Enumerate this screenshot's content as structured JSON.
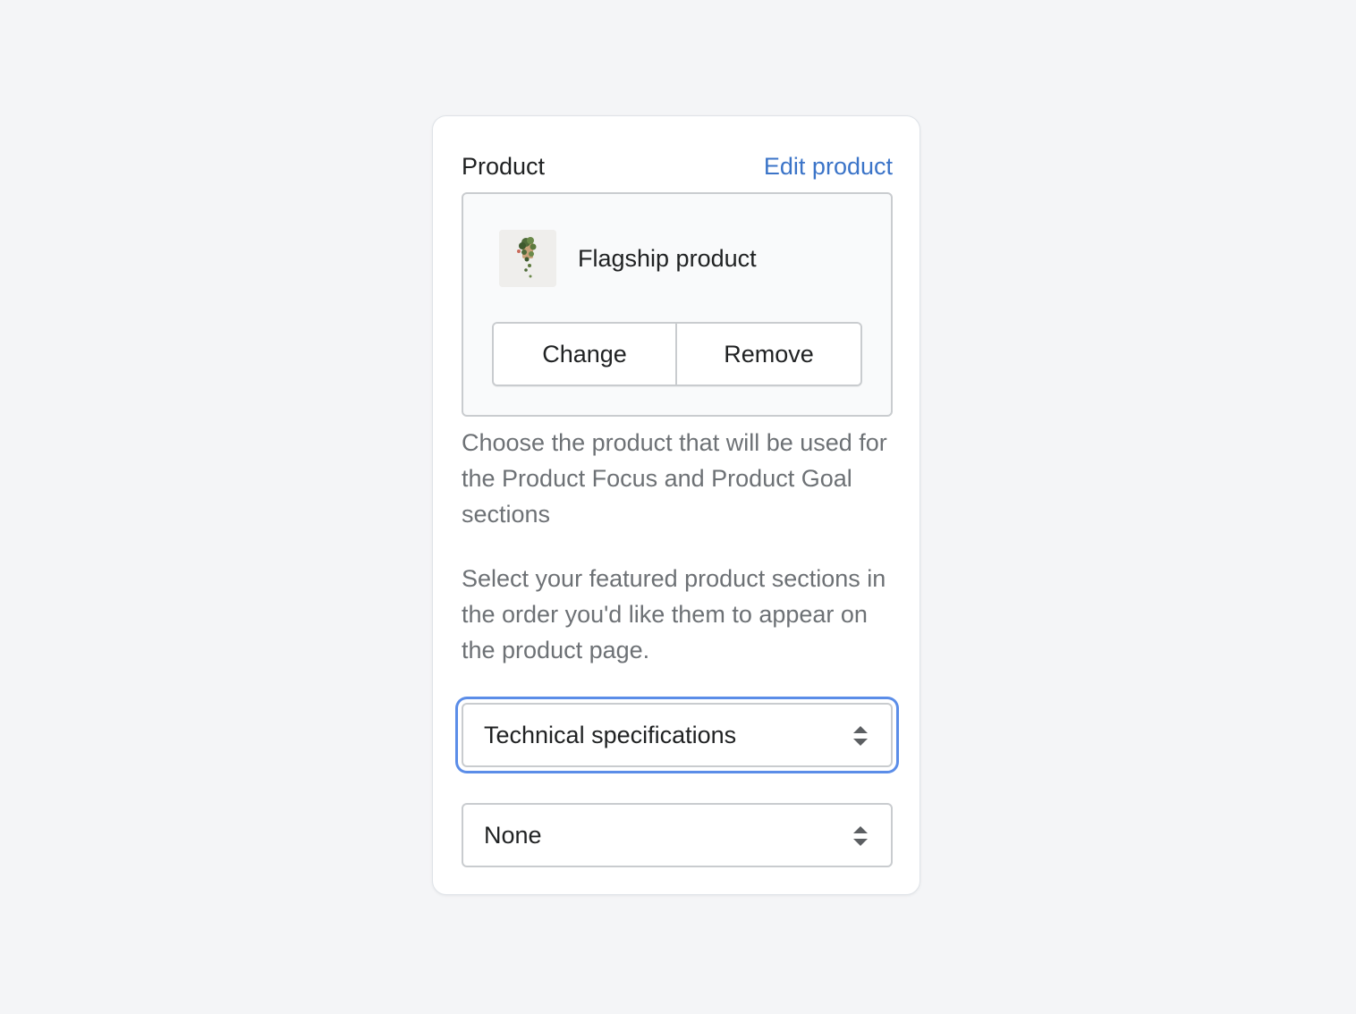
{
  "product_panel": {
    "title": "Product",
    "edit_link": "Edit product",
    "selected_product": {
      "name": "Flagship product",
      "thumbnail_icon": "hanging-plant-thumbnail"
    },
    "buttons": {
      "change": "Change",
      "remove": "Remove"
    },
    "help_text": "Choose the product that will be used for the Product Focus and Product Goal sections"
  },
  "sections_panel": {
    "instructions": "Select your featured product sections in the order you'd like them to appear on the product page.",
    "selects": [
      {
        "value": "Technical specifications",
        "focused": true
      },
      {
        "value": "None",
        "focused": false
      }
    ]
  },
  "colors": {
    "link": "#3b74c8",
    "focus_ring": "#5b8de8",
    "text_primary": "#202223",
    "text_subdued": "#6d7175",
    "page_background": "#f4f5f7"
  }
}
